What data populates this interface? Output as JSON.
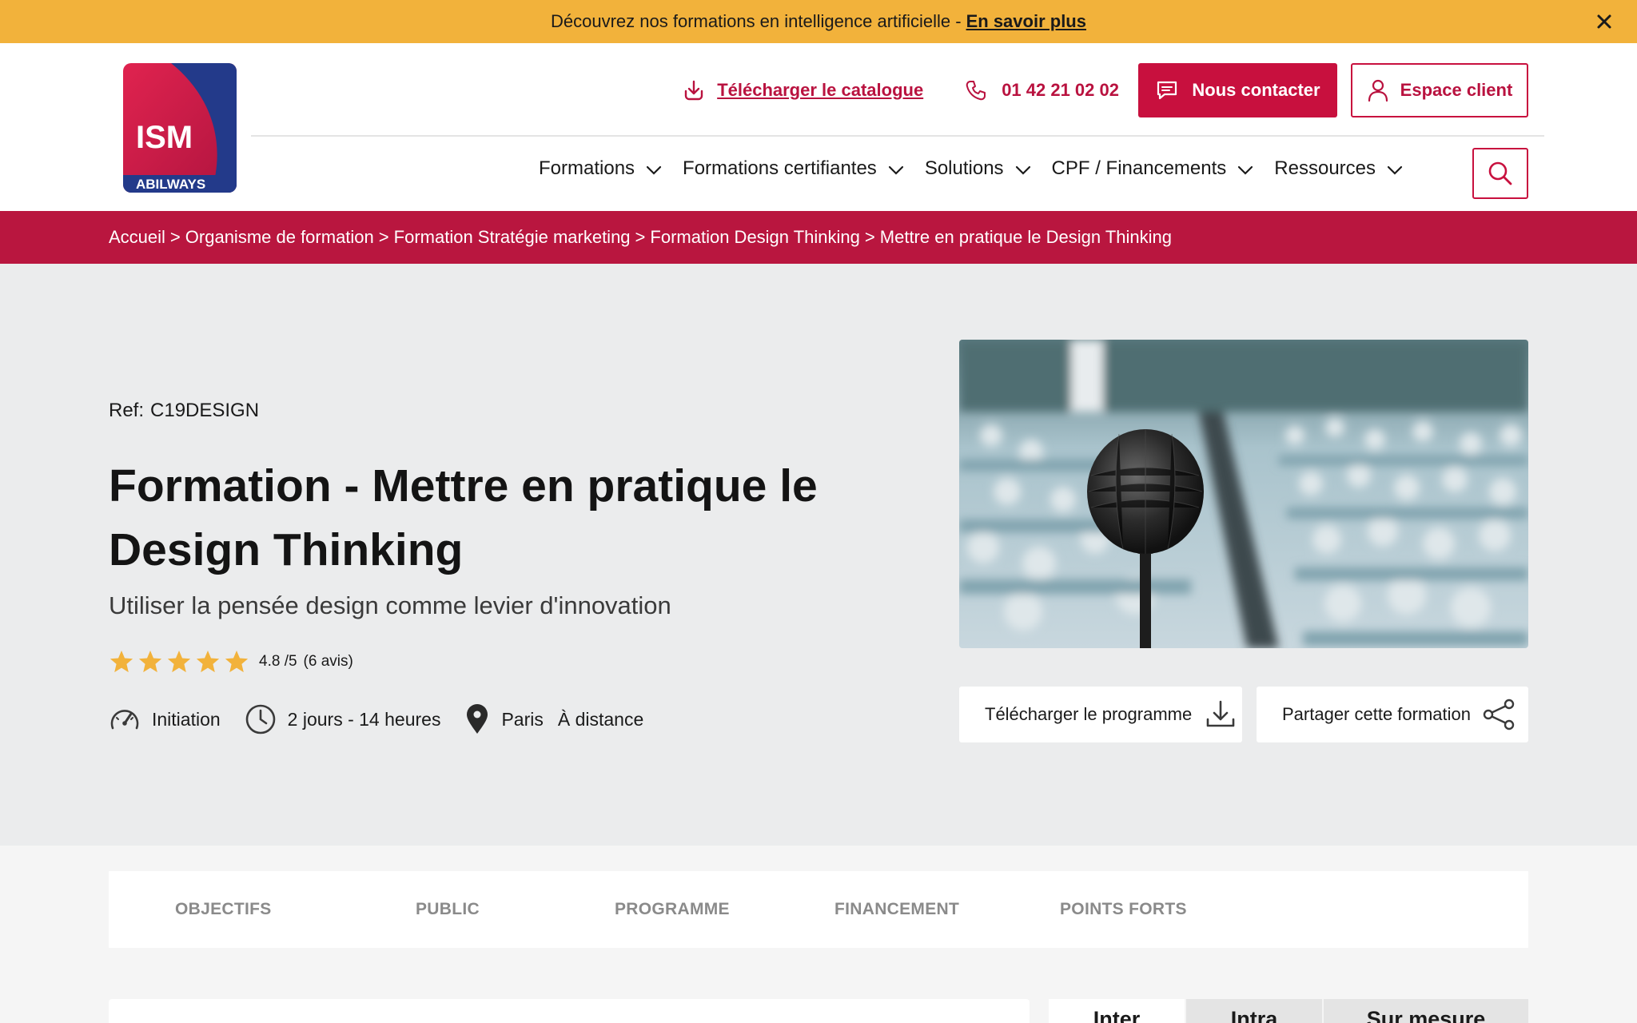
{
  "promo": {
    "text": "Découvrez nos formations en intelligence artificielle - ",
    "link": "En savoir plus",
    "bg_color": "#f2b23b"
  },
  "header": {
    "logo_top": "ISM",
    "logo_bottom": "ABILWAYS",
    "catalog_link": "Télécharger le catalogue",
    "phone": "01 42 21 02 02",
    "contact_button": "Nous contacter",
    "client_button": "Espace client",
    "accent_color": "#c8103e",
    "nav": [
      {
        "label": "Formations"
      },
      {
        "label": "Formations certifiantes"
      },
      {
        "label": "Solutions"
      },
      {
        "label": "CPF / Financements"
      },
      {
        "label": "Ressources"
      }
    ]
  },
  "breadcrumb": [
    "Accueil",
    "Organisme de formation",
    "Formation Stratégie marketing",
    "Formation Design Thinking",
    "Mettre en pratique le Design Thinking"
  ],
  "hero": {
    "ref_label": "Ref:",
    "ref_code": "C19DESIGN",
    "title": "Formation - Mettre en pratique le Design Thinking",
    "subtitle": "Utiliser la pensée design comme levier d'innovation",
    "rating_value": 4.8,
    "rating_text": "4.8 /5",
    "reviews_text": "(6 avis)",
    "star_count": 5,
    "star_color": "#f2b23b",
    "level": "Initiation",
    "duration": "2 jours - 14 heures",
    "location_1": "Paris",
    "location_2": "À distance",
    "download_program": "Télécharger le programme",
    "share": "Partager cette formation"
  },
  "tabs": [
    "OBJECTIFS",
    "PUBLIC",
    "PROGRAMME",
    "FINANCEMENT",
    "POINTS FORTS"
  ],
  "pricing_tabs": [
    "Inter",
    "Intra",
    "Sur mesure"
  ]
}
